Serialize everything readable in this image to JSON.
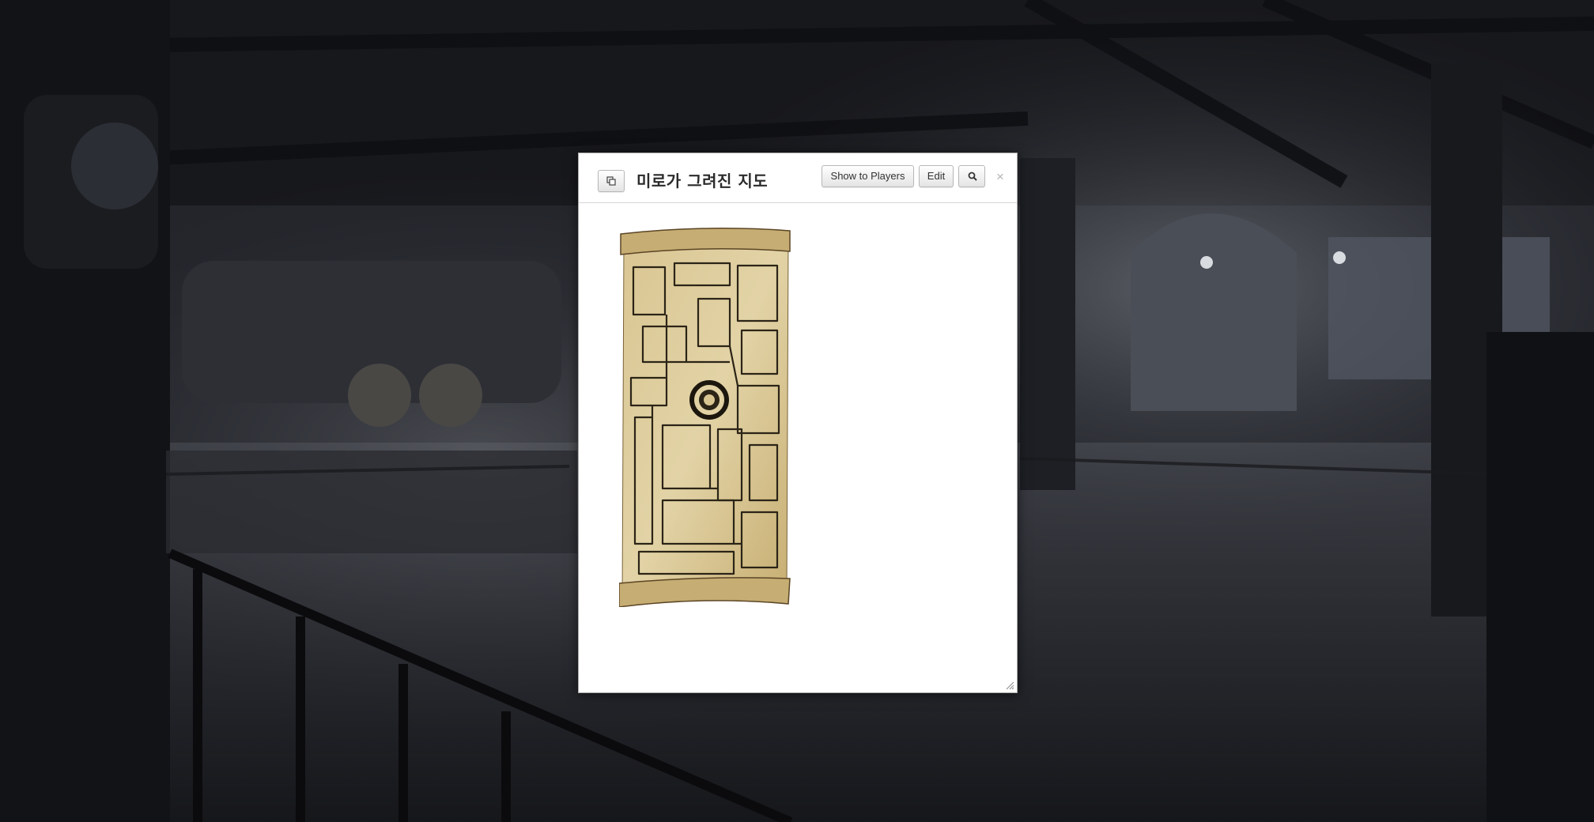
{
  "dialog": {
    "title": "미로가 그려진 지도",
    "show_to_players_label": "Show to Players",
    "edit_label": "Edit",
    "close_glyph": "×",
    "popout_icon": "popout-icon",
    "zoom_icon": "magnifier-icon"
  },
  "handout": {
    "image_description_icon": "parchment-maze-map",
    "colors": {
      "parchment": "#d8c48e",
      "ink": "#2b2417"
    }
  },
  "theme": {
    "background_scene": "dark-industrial-boiler-room",
    "dialog_background": "#ffffff"
  }
}
